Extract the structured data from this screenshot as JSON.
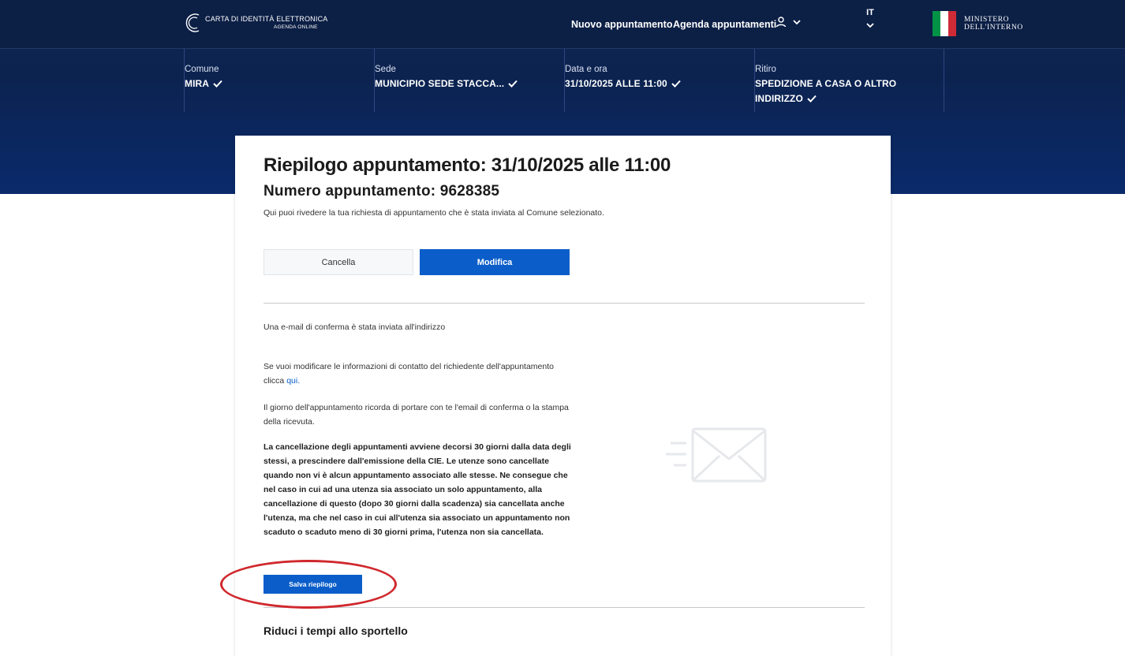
{
  "header": {
    "logo_line1": "CARTA DI IDENTITÀ ELETTRONICA",
    "logo_line2": "AGENDA ONLINE",
    "nav": [
      "Nuovo appuntamento",
      "Agenda appuntamenti"
    ],
    "user_icon": "user-icon",
    "lang": "IT",
    "ministry_line1": "MINISTERO",
    "ministry_line2": "DELL'INTERNO",
    "flag_colors": [
      "#009246",
      "#ffffff",
      "#ce2b37"
    ]
  },
  "steps": [
    {
      "label": "Comune",
      "value": "MIRA"
    },
    {
      "label": "Sede",
      "value": "MUNICIPIO SEDE STACCA..."
    },
    {
      "label": "Data e ora",
      "value": "31/10/2025 ALLE 11:00"
    },
    {
      "label": "Ritiro",
      "value_line1": "SPEDIZIONE A CASA O ALTRO",
      "value_line2": "INDIRIZZO"
    }
  ],
  "summary": {
    "title": "Riepilogo appuntamento: 31/10/2025 alle 11:00",
    "number": "Numero appuntamento: 9628385",
    "intro": "Qui puoi rivedere la tua richiesta di appuntamento che è stata inviata al Comune selezionato.",
    "cancel_label": "Cancella",
    "edit_label": "Modifica",
    "email_sent": "Una e-mail di conferma è stata inviata all'indirizzo",
    "contact_text": "Se vuoi modificare le informazioni di contatto del richiedente dell'appuntamento",
    "contact_click": "clicca",
    "contact_link": "qui.",
    "reminder": "Il giorno dell'appuntamento ricorda di portare con te l'email di conferma o la stampa della ricevuta.",
    "deletion_policy": "La cancellazione degli appuntamenti avviene decorsi 30 giorni dalla data degli stessi, a prescindere dall'emissione della CIE. Le utenze sono cancellate quando non vi è alcun appuntamento associato alle stesse. Ne consegue che nel caso in cui ad una utenza sia associato un solo appuntamento, alla cancellazione di questo (dopo 30 giorni dalla scadenza) sia cancellata anche l'utenza, ma che nel caso in cui all'utenza sia associato un appuntamento non scaduto o scaduto meno di 30 giorni prima, l'utenza non sia cancellata.",
    "save_label": "Salva riepilogo",
    "reduce_title": "Riduci i tempi allo sportello"
  },
  "colors": {
    "primary": "#0b5ec9",
    "hero": "#0c2350",
    "annotation": "#d0282d"
  }
}
